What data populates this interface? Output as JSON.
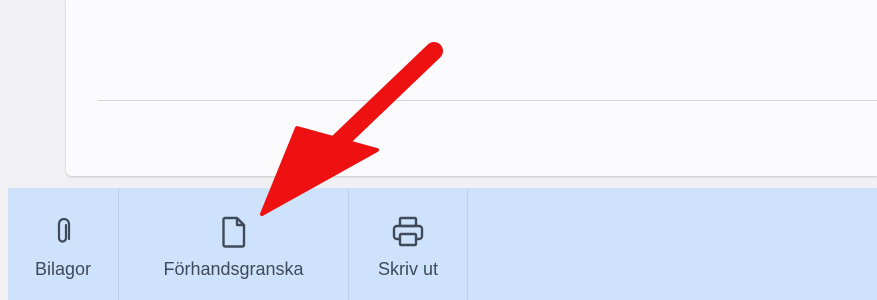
{
  "toolbar": {
    "items": [
      {
        "label": "Bilagor",
        "icon": "paperclip-icon"
      },
      {
        "label": "Förhandsgranska",
        "icon": "document-icon"
      },
      {
        "label": "Skriv ut",
        "icon": "printer-icon"
      }
    ]
  },
  "colors": {
    "toolbar_bg": "#cfe2fc",
    "icon_color": "#3e4a5a",
    "annotation_arrow": "#ee1111"
  }
}
